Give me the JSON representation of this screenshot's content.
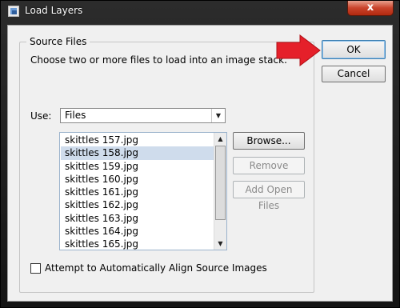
{
  "window": {
    "title": "Load Layers",
    "close_glyph": "x"
  },
  "source_files": {
    "legend": "Source Files",
    "description": "Choose two or more files to load into an image stack.",
    "use_label": "Use:",
    "use_value": "Files",
    "files": [
      "skittles 157.jpg",
      "skittles 158.jpg",
      "skittles 159.jpg",
      "skittles 160.jpg",
      "skittles 161.jpg",
      "skittles 162.jpg",
      "skittles 163.jpg",
      "skittles 164.jpg",
      "skittles 165.jpg"
    ],
    "selected_file": "skittles 158.jpg",
    "browse_label": "Browse...",
    "remove_label": "Remove",
    "add_open_files_label": "Add Open Files",
    "align_checkbox_label": "Attempt to Automatically Align Source Images",
    "align_checked": false
  },
  "buttons": {
    "ok_label": "OK",
    "cancel_label": "Cancel"
  },
  "colors": {
    "annotation_arrow": "#e5202a",
    "selection_highlight": "#cfdcec"
  },
  "icons": {
    "app": "layers-app-icon",
    "dropdown": "chevron-down-icon",
    "scroll_up": "scroll-up-arrow-icon",
    "scroll_down": "scroll-down-arrow-icon",
    "annotation": "red-arrow-icon"
  }
}
